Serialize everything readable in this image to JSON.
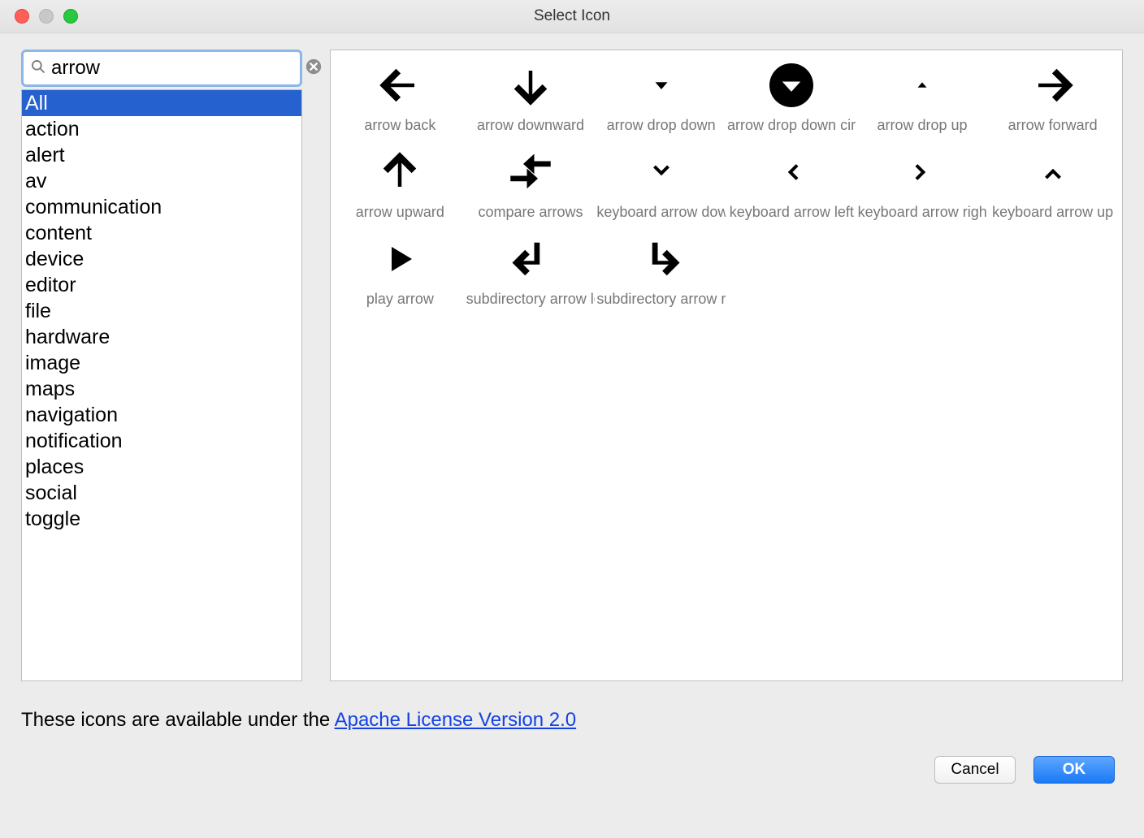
{
  "title": "Select Icon",
  "search": {
    "value": "arrow"
  },
  "categories": [
    {
      "label": "All",
      "selected": true
    },
    {
      "label": "action"
    },
    {
      "label": "alert"
    },
    {
      "label": "av"
    },
    {
      "label": "communication"
    },
    {
      "label": "content"
    },
    {
      "label": "device"
    },
    {
      "label": "editor"
    },
    {
      "label": "file"
    },
    {
      "label": "hardware"
    },
    {
      "label": "image"
    },
    {
      "label": "maps"
    },
    {
      "label": "navigation"
    },
    {
      "label": "notification"
    },
    {
      "label": "places"
    },
    {
      "label": "social"
    },
    {
      "label": "toggle"
    }
  ],
  "icons": [
    {
      "label": "arrow back",
      "graphic": "arrow-back"
    },
    {
      "label": "arrow downward",
      "graphic": "arrow-downward"
    },
    {
      "label": "arrow drop down",
      "graphic": "arrow-drop-down"
    },
    {
      "label": "arrow drop down circle",
      "graphic": "arrow-drop-down-circle"
    },
    {
      "label": "arrow drop up",
      "graphic": "arrow-drop-up"
    },
    {
      "label": "arrow forward",
      "graphic": "arrow-forward"
    },
    {
      "label": "arrow upward",
      "graphic": "arrow-upward"
    },
    {
      "label": "compare arrows",
      "graphic": "compare-arrows"
    },
    {
      "label": "keyboard arrow down",
      "graphic": "keyboard-arrow-down"
    },
    {
      "label": "keyboard arrow left",
      "graphic": "keyboard-arrow-left"
    },
    {
      "label": "keyboard arrow right",
      "graphic": "keyboard-arrow-right"
    },
    {
      "label": "keyboard arrow up",
      "graphic": "keyboard-arrow-up"
    },
    {
      "label": "play arrow",
      "graphic": "play-arrow"
    },
    {
      "label": "subdirectory arrow left",
      "graphic": "subdirectory-arrow-left"
    },
    {
      "label": "subdirectory arrow right",
      "graphic": "subdirectory-arrow-right"
    }
  ],
  "license": {
    "prefix": "These icons are available under the ",
    "link_text": "Apache License Version 2.0"
  },
  "buttons": {
    "cancel": "Cancel",
    "ok": "OK"
  }
}
